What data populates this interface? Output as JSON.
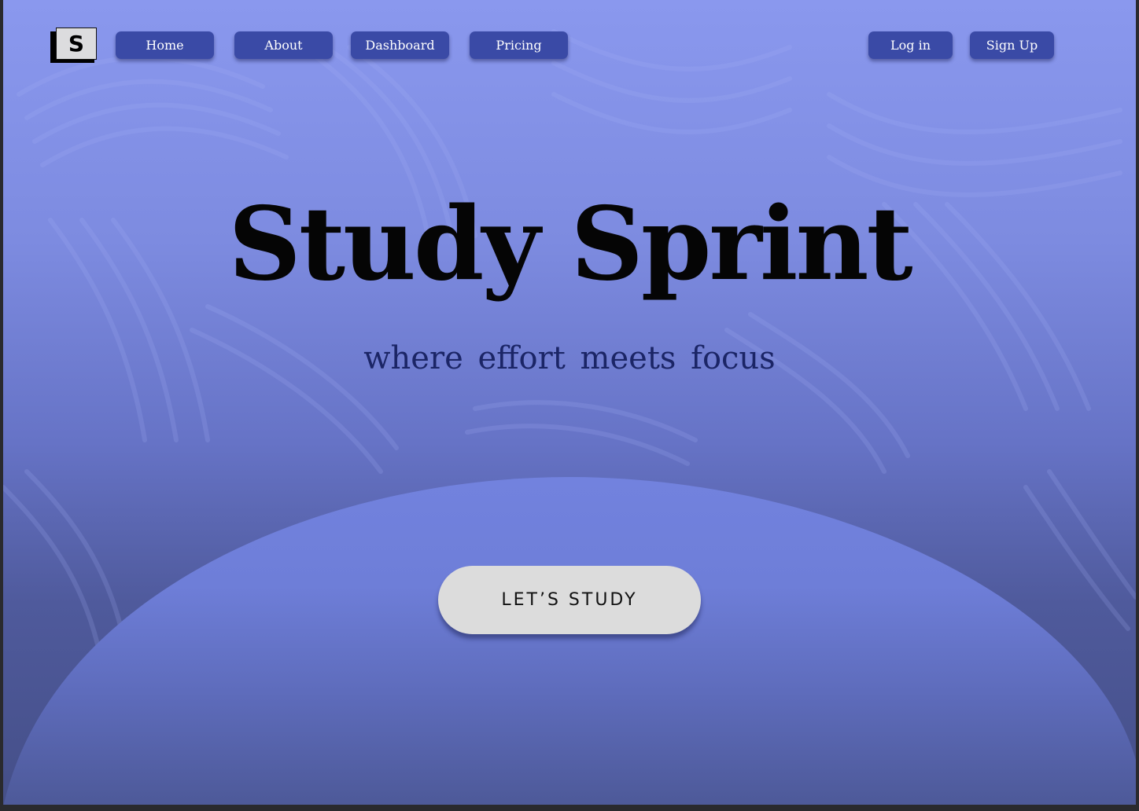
{
  "brand": {
    "logo_letter": "S"
  },
  "nav": {
    "home": "Home",
    "about": "About",
    "dashboard": "Dashboard",
    "pricing": "Pricing"
  },
  "auth": {
    "login": "Log in",
    "signup": "Sign Up"
  },
  "hero": {
    "title": "Study Sprint",
    "subtitle": "where effort meets focus",
    "cta": "LET’S STUDY"
  },
  "colors": {
    "nav_button": "#3a4aa6",
    "background_top": "#8a98ee",
    "background_bottom": "#454f88",
    "dome": "#7080dc",
    "cta_button": "#dcdcdc"
  }
}
